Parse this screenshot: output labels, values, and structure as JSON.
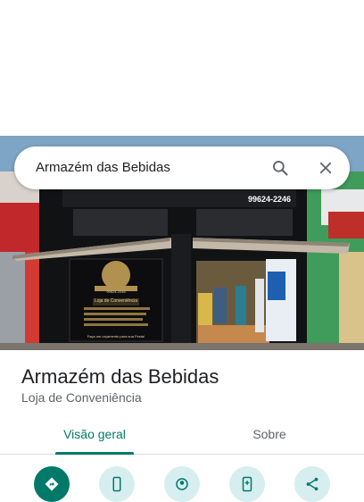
{
  "search": {
    "query": "Armazém das Bebidas"
  },
  "icons": {
    "search": "search-icon",
    "close": "close-icon"
  },
  "storefront": {
    "phone_top": "99624-2246",
    "sign_heading": "Loja de Conveniência",
    "sign_phone": "99624-2246",
    "sign_slogan": "Faça um orçamento para sua Festa!"
  },
  "place": {
    "name": "Armazém das Bebidas",
    "category": "Loja de Conveniência"
  },
  "tabs": [
    {
      "label": "Visão geral",
      "active": true
    },
    {
      "label": "Sobre",
      "active": false
    }
  ],
  "actions": [
    {
      "icon": "directions-icon"
    },
    {
      "icon": "phone-icon"
    },
    {
      "icon": "nearby-icon"
    },
    {
      "icon": "save-to-phone-icon"
    },
    {
      "icon": "share-icon"
    }
  ],
  "colors": {
    "accent": "#00796b",
    "action_bg": "#d7eef0",
    "title": "#202124",
    "secondary_text": "#5f6368"
  }
}
